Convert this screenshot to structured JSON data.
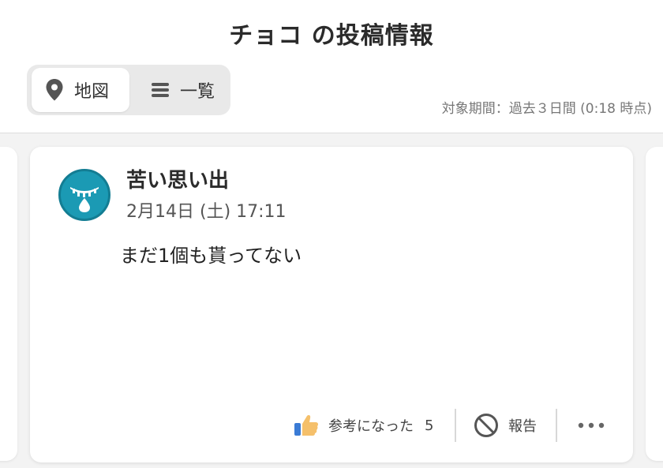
{
  "header": {
    "title": "チョコ の投稿情報",
    "tabs": [
      {
        "label": "地図",
        "icon": "map-pin-icon",
        "active": true
      },
      {
        "label": "一覧",
        "icon": "list-icon",
        "active": false
      }
    ],
    "period": "対象期間：過去３日間 (0:18 時点)"
  },
  "post": {
    "avatar_icon": "crying-face-icon",
    "title": "苦い思い出",
    "date": "2月14日 (土) 17:11",
    "body": "まだ1個も貰ってない",
    "actions": {
      "helpful_label": "参考になった",
      "helpful_count": "5",
      "report_label": "報告",
      "more_icon": "more-dots-icon"
    }
  },
  "colors": {
    "avatar": "#1b9ab4",
    "thumb_blue": "#3a7bd5",
    "thumb_skin": "#f5c06b"
  }
}
